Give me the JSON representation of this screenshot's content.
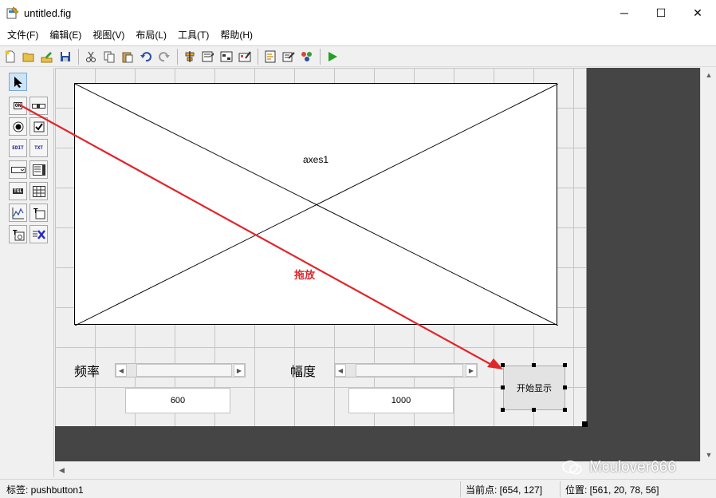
{
  "window": {
    "title": "untitled.fig",
    "controls": {
      "minimize": "─",
      "maximize": "☐",
      "close": "✕"
    }
  },
  "menu": [
    "文件(F)",
    "编辑(E)",
    "视图(V)",
    "布局(L)",
    "工具(T)",
    "帮助(H)"
  ],
  "toolbar_icons": [
    "new-file-icon",
    "open-folder-icon",
    "edit-icon",
    "save-icon",
    "cut-icon",
    "copy-icon",
    "paste-icon",
    "undo-icon",
    "redo-icon",
    "align-icon",
    "menu-editor-icon",
    "tab-order-icon",
    "toolbar-editor-icon",
    "editor-icon",
    "property-inspector-icon",
    "object-browser-icon",
    "run-icon"
  ],
  "palette": [
    {
      "name": "select-tool",
      "glyph": "➤"
    },
    {
      "name": "pushbutton-tool",
      "glyph": "OK"
    },
    {
      "name": "slider-tool",
      "glyph": "▭"
    },
    {
      "name": "radio-tool",
      "glyph": "◉"
    },
    {
      "name": "checkbox-tool",
      "glyph": "☑"
    },
    {
      "name": "edit-text-tool",
      "glyph": "EDIT"
    },
    {
      "name": "static-text-tool",
      "glyph": "TXT"
    },
    {
      "name": "popup-menu-tool",
      "glyph": "▭▾"
    },
    {
      "name": "listbox-tool",
      "glyph": "≣"
    },
    {
      "name": "toggle-tool",
      "glyph": "TGL"
    },
    {
      "name": "table-tool",
      "glyph": "▦"
    },
    {
      "name": "axes-tool",
      "glyph": "⩘"
    },
    {
      "name": "panel-tool",
      "glyph": "T"
    },
    {
      "name": "button-group-tool",
      "glyph": "T"
    },
    {
      "name": "activex-tool",
      "glyph": "X"
    }
  ],
  "canvas": {
    "axes_label": "axes1",
    "annotation": "拖放",
    "freq_label": "频率",
    "amp_label": "幅度",
    "freq_value": "600",
    "amp_value": "1000",
    "button_label": "开始显示",
    "slider_left_arrow": "◀",
    "slider_right_arrow": "▶",
    "arrow_color": "#e0262b"
  },
  "scroll": {
    "up": "▲",
    "down": "▼",
    "left": "◀"
  },
  "status": {
    "tag": "标签: pushbutton1",
    "current_point": "当前点:  [654, 127]",
    "position": "位置:  [561, 20, 78, 56]"
  },
  "watermark": "Mculover666"
}
